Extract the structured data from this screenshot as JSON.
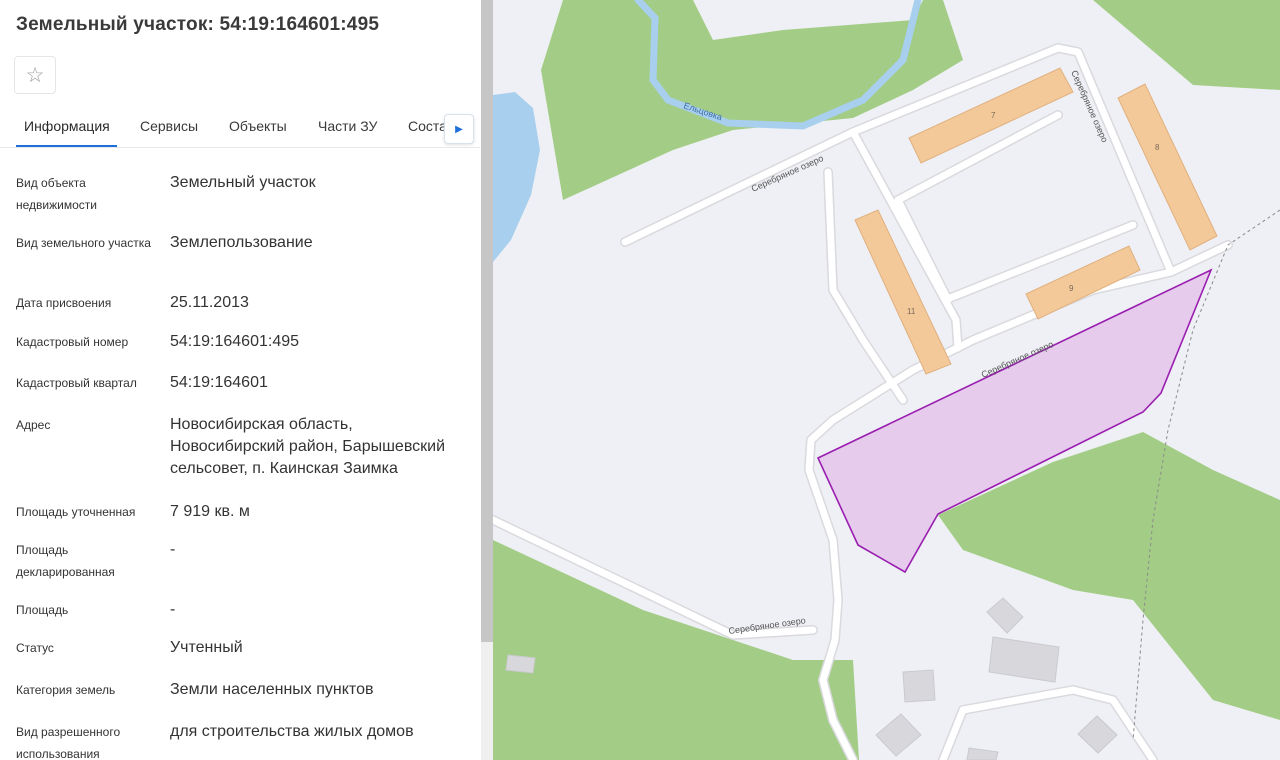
{
  "header": {
    "title": "Земельный участок: 54:19:164601:495"
  },
  "favorite": {
    "icon": "star-outline-icon",
    "glyph": "☆"
  },
  "tabs": [
    {
      "label": "Информация",
      "active": true
    },
    {
      "label": "Сервисы"
    },
    {
      "label": "Объекты"
    },
    {
      "label": "Части ЗУ"
    },
    {
      "label": "Соста"
    }
  ],
  "tab_next": {
    "icon": "chevron-right-icon",
    "glyph": "▶"
  },
  "fields": [
    {
      "label": "Вид объекта недвижимости",
      "value": "Земельный участок"
    },
    {
      "label": "Вид земельного участка",
      "value": "Землепользование"
    },
    {
      "label": "Дата присвоения",
      "value": "25.11.2013"
    },
    {
      "label": "Кадастровый номер",
      "value": "54:19:164601:495"
    },
    {
      "label": "Кадастровый квартал",
      "value": "54:19:164601"
    },
    {
      "label": "Адрес",
      "value": "Новосибирская область, Новосибирский район, Барышевский сельсовет, п. Каинская Заимка"
    },
    {
      "label": "Площадь уточненная",
      "value": "7 919 кв. м"
    },
    {
      "label": "Площадь декларированная",
      "value": "-"
    },
    {
      "label": "Площадь",
      "value": "-"
    },
    {
      "label": "Статус",
      "value": "Учтенный"
    },
    {
      "label": "Категория земель",
      "value": "Земли населенных пунктов"
    },
    {
      "label": "Вид разрешенного использования",
      "value": "для строительства жилых домов"
    }
  ],
  "map": {
    "river_name": "Ельцовка",
    "street_name": "Серебряное озеро",
    "buildings": {
      "b7": "7",
      "b8": "8",
      "b9": "9",
      "b11": "11"
    },
    "colors": {
      "background": "#eff0f5",
      "forest": "#a3cd86",
      "water": "#a8cfee",
      "building": "#f3c99a",
      "parcel_fill": "#e5c8ec",
      "parcel_stroke": "#9a1fb0",
      "road": "#ffffff"
    }
  }
}
